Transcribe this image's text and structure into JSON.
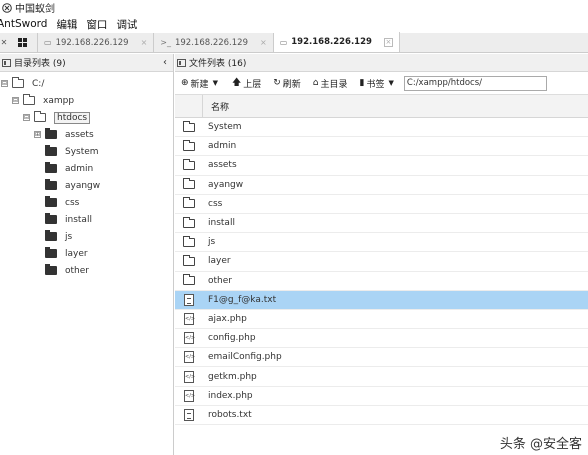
{
  "window": {
    "title": "中国蚁剑"
  },
  "menu": [
    "AntSword",
    "编辑",
    "窗口",
    "调试"
  ],
  "tabs": [
    {
      "icon": "▭",
      "label": "192.168.226.129",
      "close": "×",
      "active": false
    },
    {
      "icon": ">_",
      "label": "192.168.226.129",
      "close": "×",
      "active": false
    },
    {
      "icon": "▭",
      "label": "192.168.226.129",
      "close": "×",
      "active": true
    }
  ],
  "left_panel": {
    "title": "目录列表 (9)",
    "collapse": "‹",
    "tree": [
      {
        "label": "C:/",
        "toggle": "⊟",
        "open": true
      },
      {
        "label": "xampp",
        "toggle": "⊟",
        "open": true
      },
      {
        "label": "htdocs",
        "toggle": "⊟",
        "open": true,
        "selected": true
      },
      {
        "label": "assets",
        "toggle": "⊞"
      },
      {
        "label": "System"
      },
      {
        "label": "admin"
      },
      {
        "label": "ayangw"
      },
      {
        "label": "css"
      },
      {
        "label": "install"
      },
      {
        "label": "js"
      },
      {
        "label": "layer"
      },
      {
        "label": "other"
      }
    ]
  },
  "right_panel": {
    "title": "文件列表 (16)",
    "toolbar": {
      "new_label": "新建",
      "up_label": "上层",
      "refresh_label": "刷新",
      "home_label": "主目录",
      "bookmark_label": "书签",
      "path": "C:/xampp/htdocs/"
    },
    "column_name": "名称",
    "files": [
      {
        "name": "System",
        "type": "folder"
      },
      {
        "name": "admin",
        "type": "folder"
      },
      {
        "name": "assets",
        "type": "folder"
      },
      {
        "name": "ayangw",
        "type": "folder"
      },
      {
        "name": "css",
        "type": "folder"
      },
      {
        "name": "install",
        "type": "folder"
      },
      {
        "name": "js",
        "type": "folder"
      },
      {
        "name": "layer",
        "type": "folder"
      },
      {
        "name": "other",
        "type": "folder"
      },
      {
        "name": "F1@g_f@ka.txt",
        "type": "text",
        "highlighted": true
      },
      {
        "name": "ajax.php",
        "type": "code"
      },
      {
        "name": "config.php",
        "type": "code"
      },
      {
        "name": "emailConfig.php",
        "type": "code"
      },
      {
        "name": "getkm.php",
        "type": "code"
      },
      {
        "name": "index.php",
        "type": "code"
      },
      {
        "name": "robots.txt",
        "type": "text"
      }
    ]
  },
  "watermark": "头条 @安全客",
  "colors": {
    "highlight": "#aad4f5",
    "tabbar": "#ededed"
  }
}
